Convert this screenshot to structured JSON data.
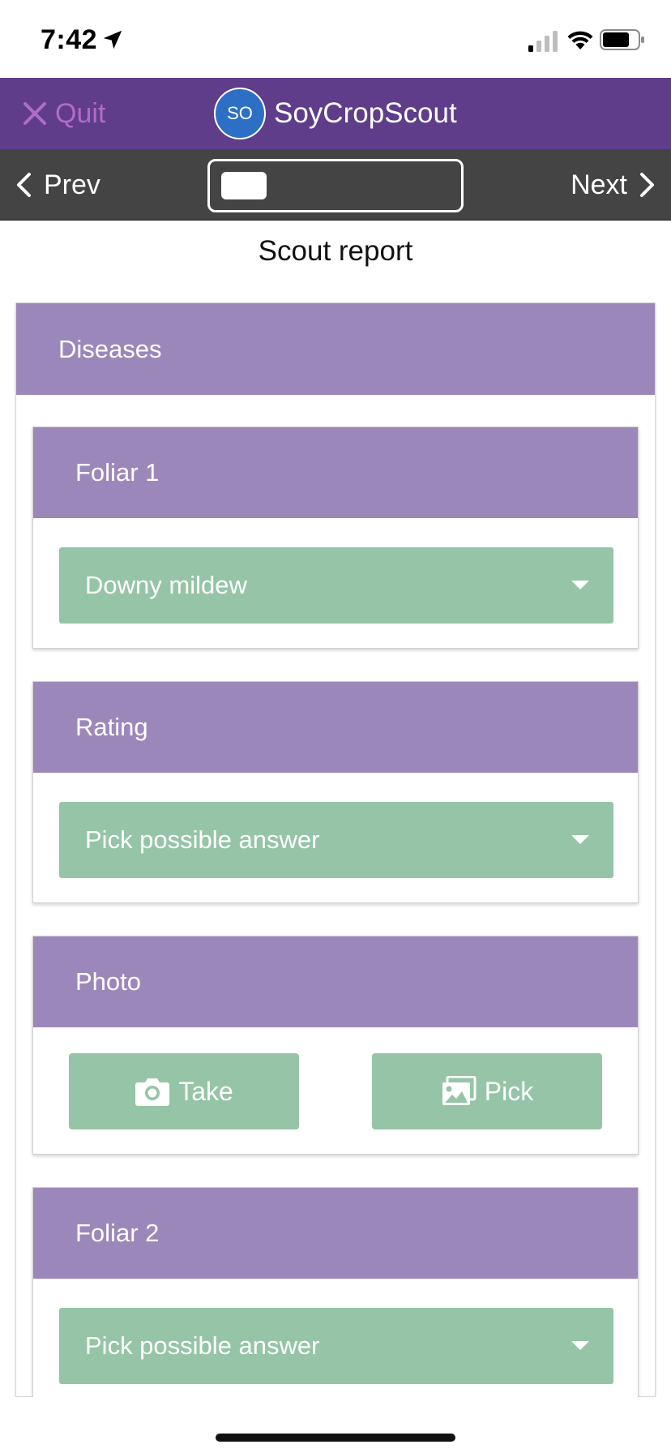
{
  "status_bar": {
    "time": "7:42",
    "icons": [
      "location-arrow-icon",
      "cellular-signal-icon",
      "wifi-icon",
      "battery-icon"
    ]
  },
  "header": {
    "quit_label": "Quit",
    "avatar_initials": "SO",
    "app_name": "SoyCropScout",
    "colors": {
      "background": "#5f3d8b",
      "quit": "#b16bc8",
      "avatar": "#2e6fc6"
    }
  },
  "nav": {
    "prev_label": "Prev",
    "next_label": "Next"
  },
  "page": {
    "title": "Scout report"
  },
  "section": {
    "title": "Diseases",
    "cards": [
      {
        "title": "Foliar 1",
        "selected_value": "Downy mildew"
      },
      {
        "title": "Rating",
        "selected_value": "Pick possible answer"
      },
      {
        "title": "Photo",
        "take_label": "Take",
        "pick_label": "Pick"
      },
      {
        "title": "Foliar 2",
        "selected_value": "Pick possible answer"
      }
    ]
  },
  "colors": {
    "card_header": "#9c87ba",
    "control": "#95c5a6",
    "nav_bar": "#444444"
  }
}
